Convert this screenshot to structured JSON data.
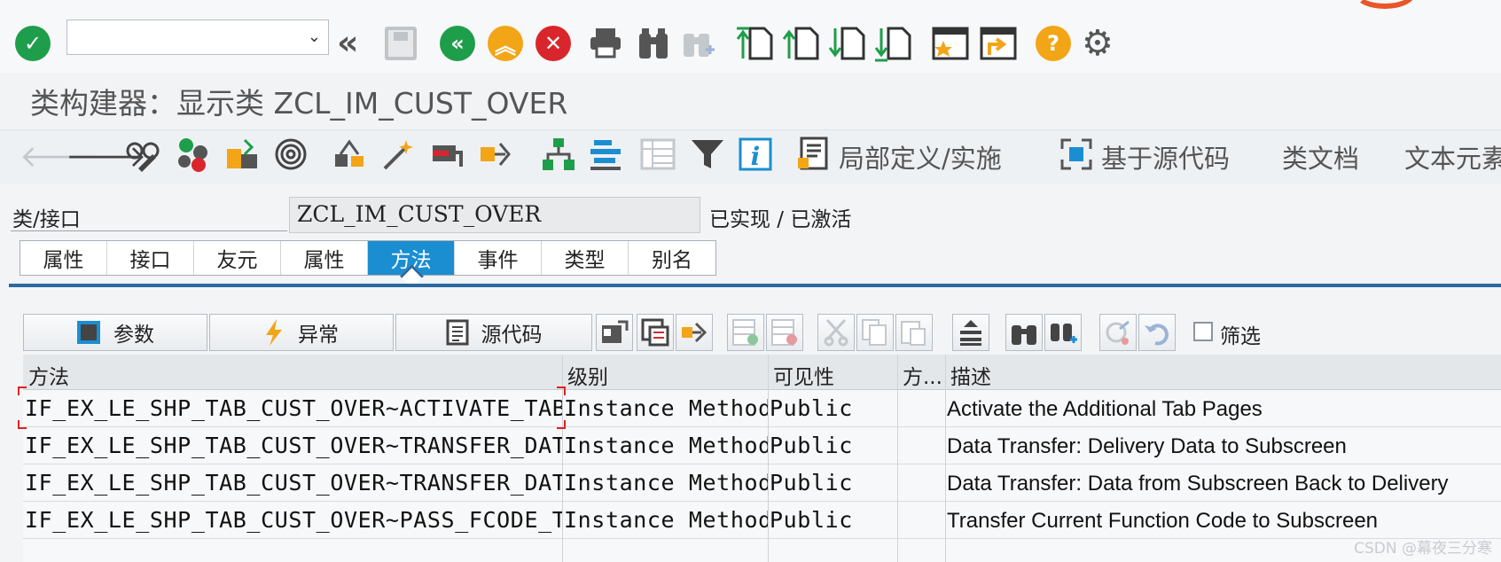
{
  "system_toolbar": {
    "command_field_value": "",
    "icons": [
      "enter-check-icon",
      "back-double-chevron-icon",
      "save-icon",
      "green-back-icon",
      "yellow-exit-icon",
      "red-cancel-icon",
      "print-icon",
      "find-icon",
      "find-next-icon",
      "first-page-icon",
      "prev-page-icon",
      "next-page-icon",
      "last-page-icon",
      "new-session-icon",
      "shortcut-icon",
      "help-icon",
      "settings-icon"
    ]
  },
  "title": "类构建器：显示类 ZCL_IM_CUST_OVER",
  "app_toolbar": {
    "local_def_label": "局部定义/实施",
    "source_based_label": "基于源代码",
    "class_doc_label": "类文档",
    "text_elements_label": "文本元素"
  },
  "class_field": {
    "label": "类/接口",
    "value": "ZCL_IM_CUST_OVER",
    "status": "已实现 / 已激活"
  },
  "tabs": [
    "属性",
    "接口",
    "友元",
    "属性",
    "方法",
    "事件",
    "类型",
    "别名"
  ],
  "active_tab": "方法",
  "method_toolbar": {
    "params_label": "参数",
    "exceptions_label": "异常",
    "source_label": "源代码",
    "filter_label": "筛选"
  },
  "table": {
    "headers": [
      "方法",
      "级别",
      "可见性",
      "方...",
      "描述"
    ],
    "rows": [
      {
        "method": "IF_EX_LE_SHP_TAB_CUST_OVER~ACTIVATE_TAB_P",
        "level": "Instance Method",
        "visibility": "Public",
        "description": "Activate the Additional Tab Pages"
      },
      {
        "method": "IF_EX_LE_SHP_TAB_CUST_OVER~TRANSFER_DATA_",
        "level": "Instance Method",
        "visibility": "Public",
        "description": "Data Transfer: Delivery Data to Subscreen"
      },
      {
        "method": "IF_EX_LE_SHP_TAB_CUST_OVER~TRANSFER_DATA_",
        "level": "Instance Method",
        "visibility": "Public",
        "description": "Data Transfer: Data from Subscreen Back to Delivery"
      },
      {
        "method": "IF_EX_LE_SHP_TAB_CUST_OVER~PASS_FCODE_TO_",
        "level": "Instance Method",
        "visibility": "Public",
        "description": "Transfer Current Function Code to Subscreen"
      }
    ]
  },
  "watermark": "CSDN @幕夜三分寒",
  "colors": {
    "accent": "#1b8ed1",
    "green": "#1e9e4a",
    "orange": "#f2a516",
    "red": "#d9262c"
  }
}
